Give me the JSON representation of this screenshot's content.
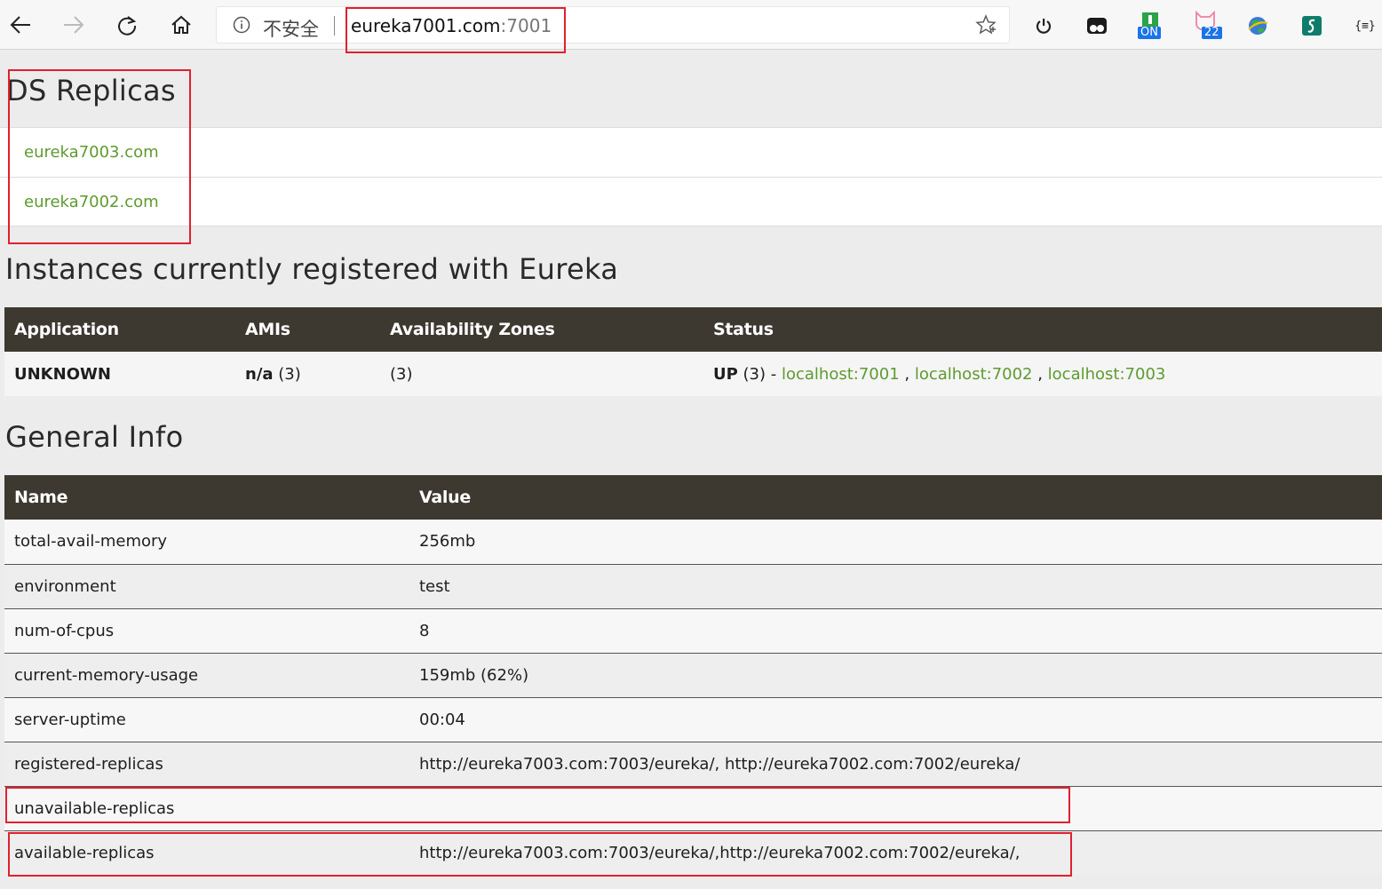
{
  "browser": {
    "insecure_label": "不安全",
    "url_host": "eureka7001.com",
    "url_port": ":7001",
    "ext_badge_on": "ON",
    "ext_badge_count": "22"
  },
  "replicas_section": {
    "title": "DS Replicas",
    "items": [
      "eureka7003.com",
      "eureka7002.com"
    ]
  },
  "instances_section": {
    "title": "Instances currently registered with Eureka",
    "headers": [
      "Application",
      "AMIs",
      "Availability Zones",
      "Status"
    ],
    "row": {
      "application": "UNKNOWN",
      "amis_bold": "n/a",
      "amis_count": " (3)",
      "zones": "(3)",
      "status_bold": "UP",
      "status_count": " (3) - ",
      "status_links": [
        "localhost:7001",
        "localhost:7002",
        "localhost:7003"
      ],
      "link_sep": " , "
    }
  },
  "general_info": {
    "title": "General Info",
    "headers": [
      "Name",
      "Value"
    ],
    "rows": [
      {
        "name": "total-avail-memory",
        "value": "256mb"
      },
      {
        "name": "environment",
        "value": "test"
      },
      {
        "name": "num-of-cpus",
        "value": "8"
      },
      {
        "name": "current-memory-usage",
        "value": "159mb (62%)"
      },
      {
        "name": "server-uptime",
        "value": "00:04"
      },
      {
        "name": "registered-replicas",
        "value": "http://eureka7003.com:7003/eureka/, http://eureka7002.com:7002/eureka/"
      },
      {
        "name": "unavailable-replicas",
        "value": ""
      },
      {
        "name": "available-replicas",
        "value": "http://eureka7003.com:7003/eureka/,http://eureka7002.com:7002/eureka/,"
      }
    ]
  },
  "colors": {
    "link": "#5e9b2e",
    "table_header": "#3d3830",
    "highlight_box": "#e0202e"
  }
}
